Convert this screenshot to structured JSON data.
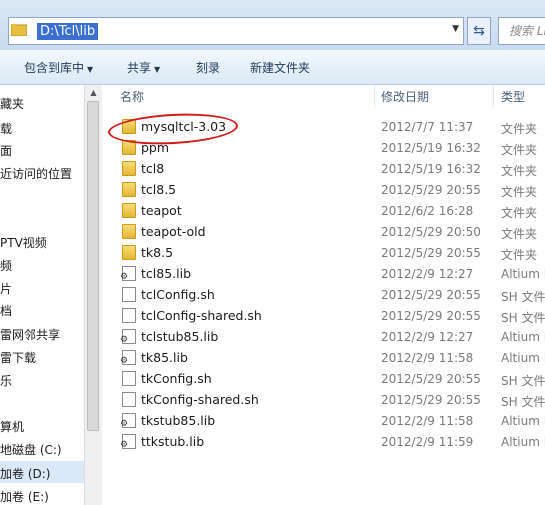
{
  "address_bar": {
    "path": "D:\\Tcl\\lib",
    "search_placeholder": "搜索 Li",
    "blurred_tabs": "                           ",
    "refresh_icon": "refresh-icon"
  },
  "toolbar": {
    "items": [
      "包含到库中",
      "共享",
      "刻录",
      "新建文件夹"
    ]
  },
  "nav": {
    "items": [
      "藏夹",
      "载",
      "面",
      "近访问的位置",
      "PTV视频",
      "频",
      "片",
      "档",
      "雷网邻共享",
      "雷下载",
      "乐",
      "算机",
      "地磁盘 (C:)",
      "加卷 (D:)",
      "加卷 (E:)"
    ]
  },
  "columns": {
    "name": "名称",
    "date": "修改日期",
    "type": "类型"
  },
  "files": [
    {
      "name": "mysqltcl-3.03",
      "date": "2012/7/7 11:37",
      "type": "文件夹",
      "icon": "folder"
    },
    {
      "name": "ppm",
      "date": "2012/5/19 16:32",
      "type": "文件夹",
      "icon": "folder"
    },
    {
      "name": "tcl8",
      "date": "2012/5/19 16:32",
      "type": "文件夹",
      "icon": "folder"
    },
    {
      "name": "tcl8.5",
      "date": "2012/5/29 20:55",
      "type": "文件夹",
      "icon": "folder"
    },
    {
      "name": "teapot",
      "date": "2012/6/2 16:28",
      "type": "文件夹",
      "icon": "folder"
    },
    {
      "name": "teapot-old",
      "date": "2012/5/29 20:50",
      "type": "文件夹",
      "icon": "folder"
    },
    {
      "name": "tk8.5",
      "date": "2012/5/29 20:55",
      "type": "文件夹",
      "icon": "folder"
    },
    {
      "name": "tcl85.lib",
      "date": "2012/2/9 12:27",
      "type": "Altium L",
      "icon": "lib"
    },
    {
      "name": "tclConfig.sh",
      "date": "2012/5/29 20:55",
      "type": "SH 文件",
      "icon": "doc"
    },
    {
      "name": "tclConfig-shared.sh",
      "date": "2012/5/29 20:55",
      "type": "SH 文件",
      "icon": "doc"
    },
    {
      "name": "tclstub85.lib",
      "date": "2012/2/9 12:27",
      "type": "Altium L",
      "icon": "lib"
    },
    {
      "name": "tk85.lib",
      "date": "2012/2/9 11:58",
      "type": "Altium L",
      "icon": "lib"
    },
    {
      "name": "tkConfig.sh",
      "date": "2012/5/29 20:55",
      "type": "SH 文件",
      "icon": "doc"
    },
    {
      "name": "tkConfig-shared.sh",
      "date": "2012/5/29 20:55",
      "type": "SH 文件",
      "icon": "doc"
    },
    {
      "name": "tkstub85.lib",
      "date": "2012/2/9 11:58",
      "type": "Altium L",
      "icon": "lib"
    },
    {
      "name": "ttkstub.lib",
      "date": "2012/2/9 11:59",
      "type": "Altium L",
      "icon": "lib"
    }
  ]
}
